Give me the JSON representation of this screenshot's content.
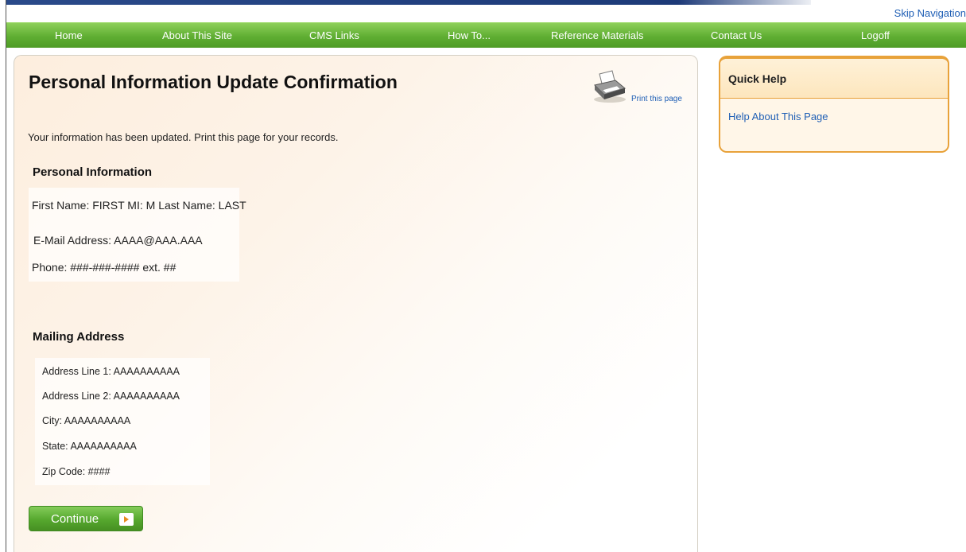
{
  "header": {
    "skip_navigation": "Skip Navigation"
  },
  "nav": {
    "items": [
      {
        "label": "Home"
      },
      {
        "label": "About This Site"
      },
      {
        "label": "CMS Links"
      },
      {
        "label": "How To..."
      },
      {
        "label": "Reference Materials"
      },
      {
        "label": "Contact Us"
      },
      {
        "label": "Logoff"
      }
    ]
  },
  "main": {
    "title": "Personal Information Update Confirmation",
    "print_link": "Print this page",
    "intro": "Your information has been updated. Print this page for your records.",
    "personal": {
      "heading": "Personal Information",
      "name_line": "First Name: FIRST  MI: M  Last Name: LAST",
      "email_line": "E-Mail Address: AAAA@AAA.AAA",
      "phone_line": "Phone: ###-###-####  ext. ##"
    },
    "mailing": {
      "heading": "Mailing Address",
      "address1": "Address Line 1:  AAAAAAAAAA",
      "address2": "Address Line 2:  AAAAAAAAAA",
      "city": "City: AAAAAAAAAA",
      "state": "State: AAAAAAAAAA",
      "zip": "Zip Code: ####"
    },
    "continue_label": "Continue"
  },
  "quick_help": {
    "title": "Quick Help",
    "link": "Help About This Page"
  },
  "colors": {
    "nav_green": "#5fae32",
    "link_blue": "#1f5fb5",
    "quick_help_border": "#e8a23a",
    "arrow_orange": "#e78a1e"
  },
  "icons": {
    "print": "printer-icon",
    "continue": "arrow-right-icon"
  }
}
